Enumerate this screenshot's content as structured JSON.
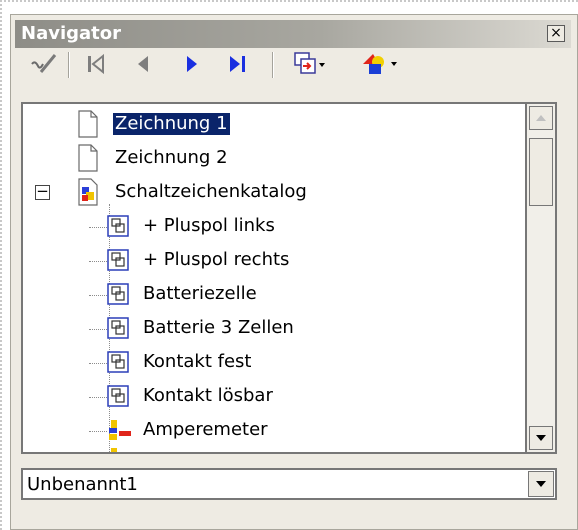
{
  "navigator": {
    "title": "Navigator",
    "close_label": "×",
    "toolbar": {
      "icons": [
        "shapes-pointer-icon",
        "first-page-icon",
        "previous-page-icon",
        "next-page-icon",
        "last-page-icon",
        "drag-mode-icon",
        "document-shapes-icon"
      ]
    },
    "tree": {
      "items": [
        {
          "label": "Zeichnung 1",
          "icon": "page-icon",
          "selected": true
        },
        {
          "label": "Zeichnung 2",
          "icon": "page-icon"
        },
        {
          "label": "Schaltzeichenkatalog",
          "icon": "draw-document-icon",
          "expanded": true
        },
        {
          "label": "+ Pluspol links",
          "icon": "shape-group-icon"
        },
        {
          "label": "+ Pluspol rechts",
          "icon": "shape-group-icon"
        },
        {
          "label": "Batteriezelle",
          "icon": "shape-group-icon"
        },
        {
          "label": "Batterie 3 Zellen",
          "icon": "shape-group-icon"
        },
        {
          "label": "Kontakt fest",
          "icon": "shape-group-icon"
        },
        {
          "label": "Kontakt lösbar",
          "icon": "shape-group-icon"
        },
        {
          "label": "Amperemeter",
          "icon": "shapes-icon"
        }
      ],
      "expand_toggle": "−"
    },
    "document_select": {
      "value": "Unbenannt1"
    }
  }
}
